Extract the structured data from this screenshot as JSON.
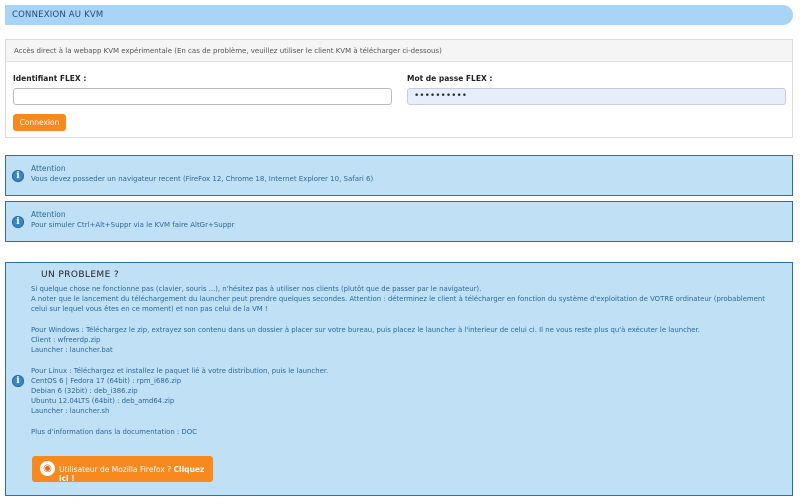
{
  "header": {
    "title": "CONNEXION AU KVM"
  },
  "login": {
    "info": "Accès direct à la webapp KVM expérimentale (En cas de problème, veuillez utiliser le client KVM à télécharger ci-dessous)",
    "username_label": "Identifiant FLEX :",
    "username_value": "",
    "password_label": "Mot de passe FLEX :",
    "password_value": "••••••••••",
    "submit_label": "Connexion"
  },
  "alerts": [
    {
      "icon": "info-icon",
      "heading": "Attention",
      "body": "Vous devez posseder un navigateur recent (FireFox 12, Chrome 18, Internet Explorer 10, Safari 6)"
    },
    {
      "icon": "info-icon",
      "heading": "Attention",
      "body": "Pour simuler Ctrl+Alt+Suppr via le KVM faire AltGr+Suppr"
    }
  ],
  "problem": {
    "title": "UN PROBLEME ?",
    "lines": [
      "Si quelque chose ne fonctionne pas (clavier, souris ...), n'hésitez pas à utiliser nos clients (plutôt que de passer par le navigateur).",
      "A noter que le lancement du téléchargement du launcher peut prendre quelques secondes. Attention : déterminez le client à télécharger en fonction du système d'exploitation de VOTRE ordinateur (probablement",
      "celui sur lequel vous êtes en ce moment) et non pas celui de la VM !",
      "",
      "Pour Windows : Téléchargez le zip, extrayez son contenu dans un dossier à placer sur votre bureau, puis placez le launcher à l'interieur de celui ci. Il ne vous reste plus qu'à exécuter le launcher.",
      "Client : wfreerdp.zip",
      "Launcher : launcher.bat",
      "",
      "Pour Linux : Téléchargez et installez le paquet lié à votre distribution, puis le launcher.",
      "CentOS 6 | Fedora 17 (64bit) : rpm_i686.zip",
      "Debian 6 (32bit) : deb_i386.zip",
      "Ubuntu 12.04LTS (64bit) : deb_amd64.zip",
      "Launcher : launcher.sh",
      "",
      "Plus d'information dans la documentation : DOC"
    ],
    "firefox_button": {
      "prefix": "Utilisateur de Mozilla Firefox ? ",
      "link": "Cliquez ici !"
    }
  },
  "colors": {
    "header_bg": "#a8d4f7",
    "accent_orange": "#f7891f",
    "alert_bg": "#bfe0f5",
    "alert_border": "#2d6fa3"
  }
}
